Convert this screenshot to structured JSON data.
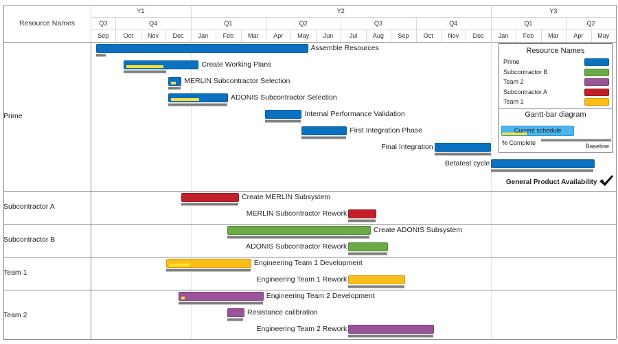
{
  "chart_data": {
    "type": "gantt",
    "title": "",
    "row_header": "Resource Names",
    "timeline": {
      "years": [
        {
          "label": "Y1",
          "start": 0,
          "end": 4
        },
        {
          "label": "Y2",
          "start": 4,
          "end": 16
        },
        {
          "label": "Y3",
          "start": 16,
          "end": 21
        }
      ],
      "quarters": [
        {
          "label": "Q3",
          "start": 0,
          "end": 1
        },
        {
          "label": "Q4",
          "start": 1,
          "end": 4
        },
        {
          "label": "Q1",
          "start": 4,
          "end": 7
        },
        {
          "label": "Q2",
          "start": 7,
          "end": 10
        },
        {
          "label": "Q3",
          "start": 10,
          "end": 13
        },
        {
          "label": "Q4",
          "start": 13,
          "end": 16
        },
        {
          "label": "Q1",
          "start": 16,
          "end": 19
        },
        {
          "label": "Q2",
          "start": 19,
          "end": 21
        }
      ],
      "months": [
        "Sep",
        "Oct",
        "Nov",
        "Dec",
        "Jan",
        "Feb",
        "Mar",
        "Apr",
        "May",
        "Jun",
        "Jul",
        "Aug",
        "Sep",
        "Oct",
        "Nov",
        "Dec",
        "Jan",
        "Feb",
        "Mar",
        "Apr",
        "May"
      ],
      "unit": "months from start of Sep Y1",
      "today_marker_month": 4
    },
    "groups": [
      {
        "name": "Prime",
        "color": "#0a70c0",
        "border": "#0a5ea2",
        "rows": 9
      },
      {
        "name": "Subcontractor A",
        "color": "#c21f2a",
        "border": "#9a1820",
        "rows": 2
      },
      {
        "name": "Subcontractor B",
        "color": "#6aab45",
        "border": "#4f8a33",
        "rows": 2
      },
      {
        "name": "Team 1",
        "color": "#fbbd17",
        "border": "#e09b00",
        "rows": 2
      },
      {
        "name": "Team 2",
        "color": "#9a5399",
        "border": "#7a3d7a",
        "rows": 3
      }
    ],
    "tasks": [
      {
        "group": 0,
        "row": 0,
        "name": "Assemble Resources",
        "start": 0.22,
        "end": 8.69,
        "baseline": [
          0.22,
          0.6
        ],
        "progress": 0,
        "label_side": "right"
      },
      {
        "group": 0,
        "row": 1,
        "name": "Create Working Plans",
        "start": 1.31,
        "end": 4.32,
        "baseline": [
          1.31,
          3.03
        ],
        "progress": 0.51,
        "label_side": "right"
      },
      {
        "group": 0,
        "row": 2,
        "name": "MERLIN Subcontractor Selection",
        "start": 3.09,
        "end": 3.63,
        "baseline": [
          3.09,
          3.6
        ],
        "progress": 0.45,
        "label_side": "right"
      },
      {
        "group": 0,
        "row": 3,
        "name": "ADONIS Subcontractor Selection",
        "start": 3.09,
        "end": 5.49,
        "baseline": [
          3.09,
          5.46
        ],
        "progress": 0.5,
        "label_side": "right"
      },
      {
        "group": 0,
        "row": 4,
        "name": "Internal Performance Validation",
        "start": 6.97,
        "end": 8.44,
        "baseline": [
          6.97,
          8.4
        ],
        "progress": 0,
        "label_side": "right"
      },
      {
        "group": 0,
        "row": 5,
        "name": "First Integration Phase",
        "start": 8.44,
        "end": 10.25,
        "baseline": [
          8.44,
          10.22
        ],
        "progress": 0,
        "label_side": "right"
      },
      {
        "group": 0,
        "row": 6,
        "name": "Final Integration",
        "start": 13.74,
        "end": 16.01,
        "baseline": [
          13.74,
          16.0
        ],
        "progress": 0,
        "label_side": "left"
      },
      {
        "group": 0,
        "row": 7,
        "name": "Betatest cycle",
        "start": 16.01,
        "end": 20.14,
        "baseline": [
          16.01,
          20.1
        ],
        "progress": 0,
        "label_side": "left"
      },
      {
        "group": 1,
        "row": 0,
        "name": "Create MERLIN Subsystem",
        "start": 3.63,
        "end": 5.93,
        "baseline": [
          3.63,
          5.9
        ],
        "progress": 0,
        "label_side": "right"
      },
      {
        "group": 1,
        "row": 1,
        "name": "MERLIN Subcontractor Rework",
        "start": 10.3,
        "end": 11.42,
        "baseline": [
          10.3,
          11.4
        ],
        "progress": 0,
        "label_side": "left"
      },
      {
        "group": 2,
        "row": 0,
        "name": "Create ADONIS Subsystem",
        "start": 5.46,
        "end": 11.2,
        "baseline": [
          5.46,
          11.15
        ],
        "progress": 0,
        "label_side": "right"
      },
      {
        "group": 2,
        "row": 1,
        "name": "ADONIS Subcontractor Rework",
        "start": 10.3,
        "end": 11.89,
        "baseline": [
          10.3,
          11.85
        ],
        "progress": 0,
        "label_side": "left"
      },
      {
        "group": 3,
        "row": 0,
        "name": "Engineering Team 1 Development",
        "start": 3.03,
        "end": 6.42,
        "baseline": [
          3.03,
          6.4
        ],
        "progress": 0.25,
        "label_side": "right"
      },
      {
        "group": 3,
        "row": 1,
        "name": "Engineering Team 1 Rework",
        "start": 10.3,
        "end": 12.57,
        "baseline": [
          10.3,
          12.55
        ],
        "progress": 0,
        "label_side": "left"
      },
      {
        "group": 4,
        "row": 0,
        "name": "Engineering Team 2 Development",
        "start": 3.5,
        "end": 6.91,
        "baseline": [
          3.5,
          6.9
        ],
        "progress": 0.04,
        "label_side": "right"
      },
      {
        "group": 4,
        "row": 1,
        "name": "Resistance calibration",
        "start": 5.46,
        "end": 6.15,
        "baseline": [
          5.46,
          6.1
        ],
        "progress": 0,
        "label_side": "right"
      },
      {
        "group": 4,
        "row": 2,
        "name": "Engineering Team 2 Rework",
        "start": 10.3,
        "end": 13.72,
        "baseline": [
          10.3,
          13.7
        ],
        "progress": 0,
        "label_side": "left"
      }
    ],
    "milestones": [
      {
        "group": 0,
        "row": 8,
        "name": "General Product Availability",
        "at": 20.3,
        "icon": "checkmark-icon",
        "label_side": "left"
      }
    ],
    "legend": {
      "title": "Resource Names",
      "items": [
        {
          "label": "Prime",
          "color": "#0a70c0",
          "border": "#0a5ea2"
        },
        {
          "label": "Subcontractor B",
          "color": "#6aab45",
          "border": "#4f8a33"
        },
        {
          "label": "Team 2",
          "color": "#9a5399",
          "border": "#7a3d7a"
        },
        {
          "label": "Subcontractor A",
          "color": "#c21f2a",
          "border": "#9a1820"
        },
        {
          "label": "Team 1",
          "color": "#fbbd17",
          "border": "#e09b00"
        }
      ],
      "key_title": "Gantt-bar diagram",
      "key_current": "Current schedule",
      "key_complete": "% Complete",
      "key_baseline": "Baseline",
      "key_color": "#4bb6f0",
      "progress_color": "#ffe033",
      "baseline_color": "#7f7f7f"
    }
  }
}
